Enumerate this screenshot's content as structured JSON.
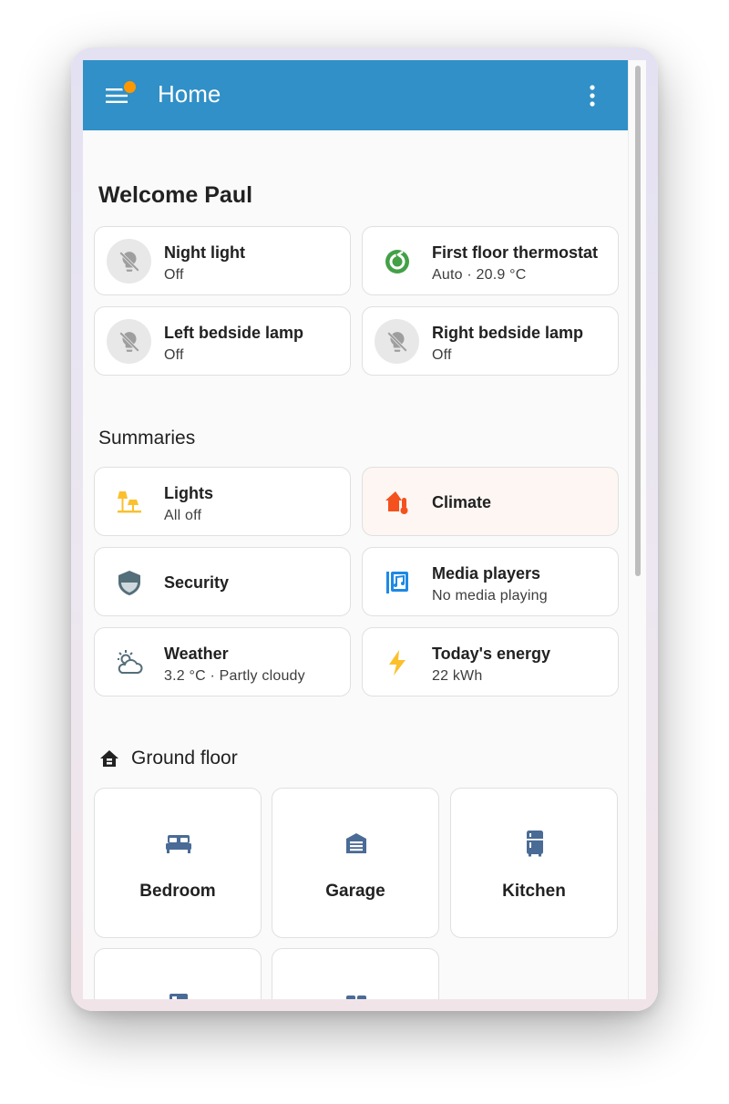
{
  "header": {
    "title": "Home"
  },
  "welcome": "Welcome Paul",
  "entities": [
    {
      "name": "Night light",
      "state": "Off",
      "icon": "lightbulb-off-icon"
    },
    {
      "name": "First floor thermostat",
      "state": "Auto · 20.9 °C",
      "icon": "thermostat-icon"
    },
    {
      "name": "Left bedside lamp",
      "state": "Off",
      "icon": "lightbulb-off-icon"
    },
    {
      "name": "Right bedside lamp",
      "state": "Off",
      "icon": "lightbulb-off-icon"
    }
  ],
  "summaries": {
    "heading": "Summaries",
    "items": [
      {
        "name": "Lights",
        "state": "All off",
        "icon": "lamps-icon"
      },
      {
        "name": "Climate",
        "state": "",
        "icon": "home-thermometer-icon"
      },
      {
        "name": "Security",
        "state": "",
        "icon": "shield-icon"
      },
      {
        "name": "Media players",
        "state": "No media playing",
        "icon": "media-library-icon"
      },
      {
        "name": "Weather",
        "state": "3.2 °C · Partly cloudy",
        "icon": "partly-cloudy-icon"
      },
      {
        "name": "Today's energy",
        "state": "22 kWh",
        "icon": "lightning-icon"
      }
    ]
  },
  "floor": {
    "heading": "Ground floor",
    "areas": [
      {
        "name": "Bedroom",
        "icon": "bed-icon"
      },
      {
        "name": "Garage",
        "icon": "garage-icon"
      },
      {
        "name": "Kitchen",
        "icon": "fridge-icon"
      },
      {
        "name": "",
        "icon": "room-icon"
      },
      {
        "name": "",
        "icon": "room-icon"
      }
    ]
  },
  "colors": {
    "header": "#3090c7",
    "notification": "#ff9800",
    "thermostat": "#43a047",
    "lights": "#fbc02d",
    "climate": "#f4511e",
    "area_icon": "#4a6b96",
    "energy": "#fbc02d"
  }
}
